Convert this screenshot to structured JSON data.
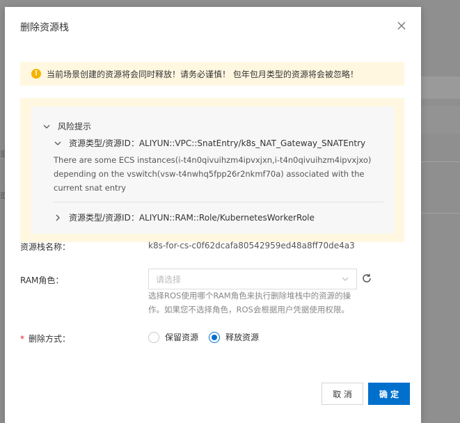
{
  "background": {
    "edge_chars": [
      "或",
      "或"
    ]
  },
  "dialog": {
    "title": "删除资源栈",
    "close_icon": "close-icon"
  },
  "warning": {
    "icon": "warning-circle-icon",
    "icon_glyph": "!",
    "text": "当前场景创建的资源将会同时释放！请务必谨慎！ 包年包月类型的资源将会被忽略！"
  },
  "risk": {
    "title": "风险提示",
    "items": [
      {
        "label": "资源类型/资源ID：ALIYUN::VPC::SnatEntry/k8s_NAT_Gateway_SNATEntry",
        "expanded": true,
        "description": "There are some ECS instances(i-t4n0qivuihzm4ipvxjxn,i-t4n0qivuihzm4ipvxjxo) depending on the vswitch(vsw-t4nwhq5fpp26r2nkmf70a) associated with the current snat entry"
      },
      {
        "label": "资源类型/资源ID：ALIYUN::RAM::Role/KubernetesWorkerRole",
        "expanded": false
      }
    ]
  },
  "form": {
    "stack_name_label": "资源栈名称：",
    "stack_name_value": "k8s-for-cs-c0f62dcafa80542959ed48a8ff70de4a3",
    "ram_role_label": "RAM角色：",
    "ram_role_placeholder": "请选择",
    "ram_role_help": "选择ROS使用哪个RAM角色来执行删除堆栈中的资源的操作。如果您不选择角色，ROS会根据用户凭据使用权限。",
    "delete_method_label": "删除方式：",
    "required_mark": "*",
    "options": [
      {
        "label": "保留资源",
        "checked": false
      },
      {
        "label": "释放资源",
        "checked": true
      }
    ]
  },
  "footer": {
    "cancel_label": "取 消",
    "ok_label": "确 定"
  },
  "colors": {
    "primary": "#0070cc",
    "warning_bg": "#fff7e0",
    "warning_icon": "#f5b400",
    "required": "#e02020"
  }
}
